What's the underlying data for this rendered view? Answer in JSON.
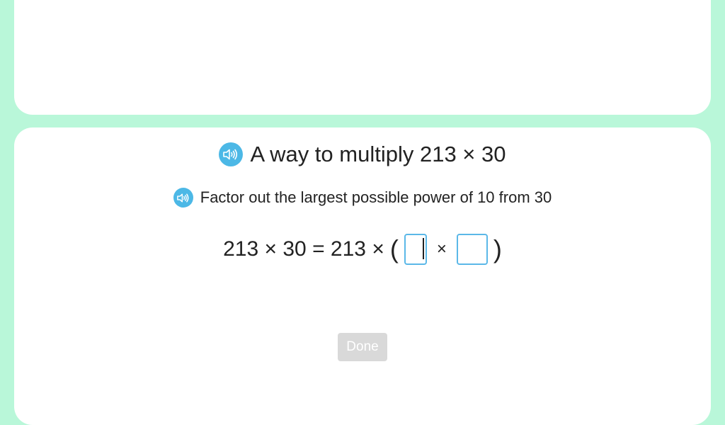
{
  "question": {
    "title": "A way to multiply 213 × 30",
    "instruction": "Factor out the largest possible power of 10 from 30",
    "equation_prefix": "213 × 30 = 213 ×",
    "open_paren": "(",
    "times_symbol": "×",
    "close_paren": ")",
    "answer_1_value": "",
    "answer_2_value": ""
  },
  "icons": {
    "title_audio": "speaker-icon",
    "instruction_audio": "speaker-icon"
  },
  "done_button": {
    "label": "Done",
    "enabled": false
  },
  "colors": {
    "background": "#b9f7d9",
    "card": "#ffffff",
    "speaker": "#4cb8e6",
    "input_border": "#5bb8e8",
    "done_disabled": "#d9d9d9"
  }
}
